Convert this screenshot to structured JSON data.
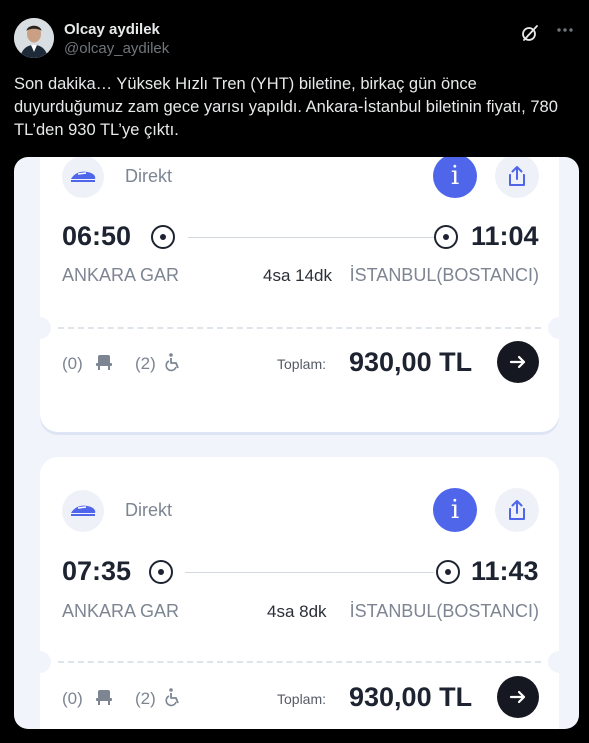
{
  "author": {
    "name": "Olcay aydilek",
    "handle": "@olcay_aydilek"
  },
  "tweet": {
    "text": "Son dakika… Yüksek Hızlı Tren (YHT) biletine, birkaç gün önce duyurduğumuz zam gece yarısı yapıldı. Ankara-İstanbul biletinin fiyatı, 780 TL’den 930 TL’ye çıktı."
  },
  "icons": {
    "grok": "grok-icon",
    "more": "more-dots-icon",
    "train": "high-speed-train-icon",
    "info": "info-icon",
    "share": "share-icon",
    "seat": "seat-icon",
    "wheelchair": "wheelchair-icon",
    "arrow": "arrow-right-icon"
  },
  "colors": {
    "info_button": "#4f66ea",
    "go_button": "#151820",
    "accent_text": "#1d2330"
  },
  "trips": [
    {
      "route_type": "Direkt",
      "info_label": "i",
      "departure_time": "06:50",
      "arrival_time": "11:04",
      "from_station": "ANKARA GAR",
      "to_station": "İSTANBUL(BOSTANCI)",
      "duration": "4sa 14dk",
      "economy_seats": "(0)",
      "accessible_seats": "(2)",
      "total_label": "Toplam:",
      "price": "930,00 TL"
    },
    {
      "route_type": "Direkt",
      "info_label": "i",
      "departure_time": "07:35",
      "arrival_time": "11:43",
      "from_station": "ANKARA GAR",
      "to_station": "İSTANBUL(BOSTANCI)",
      "duration": "4sa 8dk",
      "economy_seats": "(0)",
      "accessible_seats": "(2)",
      "total_label": "Toplam:",
      "price": "930,00 TL"
    }
  ]
}
